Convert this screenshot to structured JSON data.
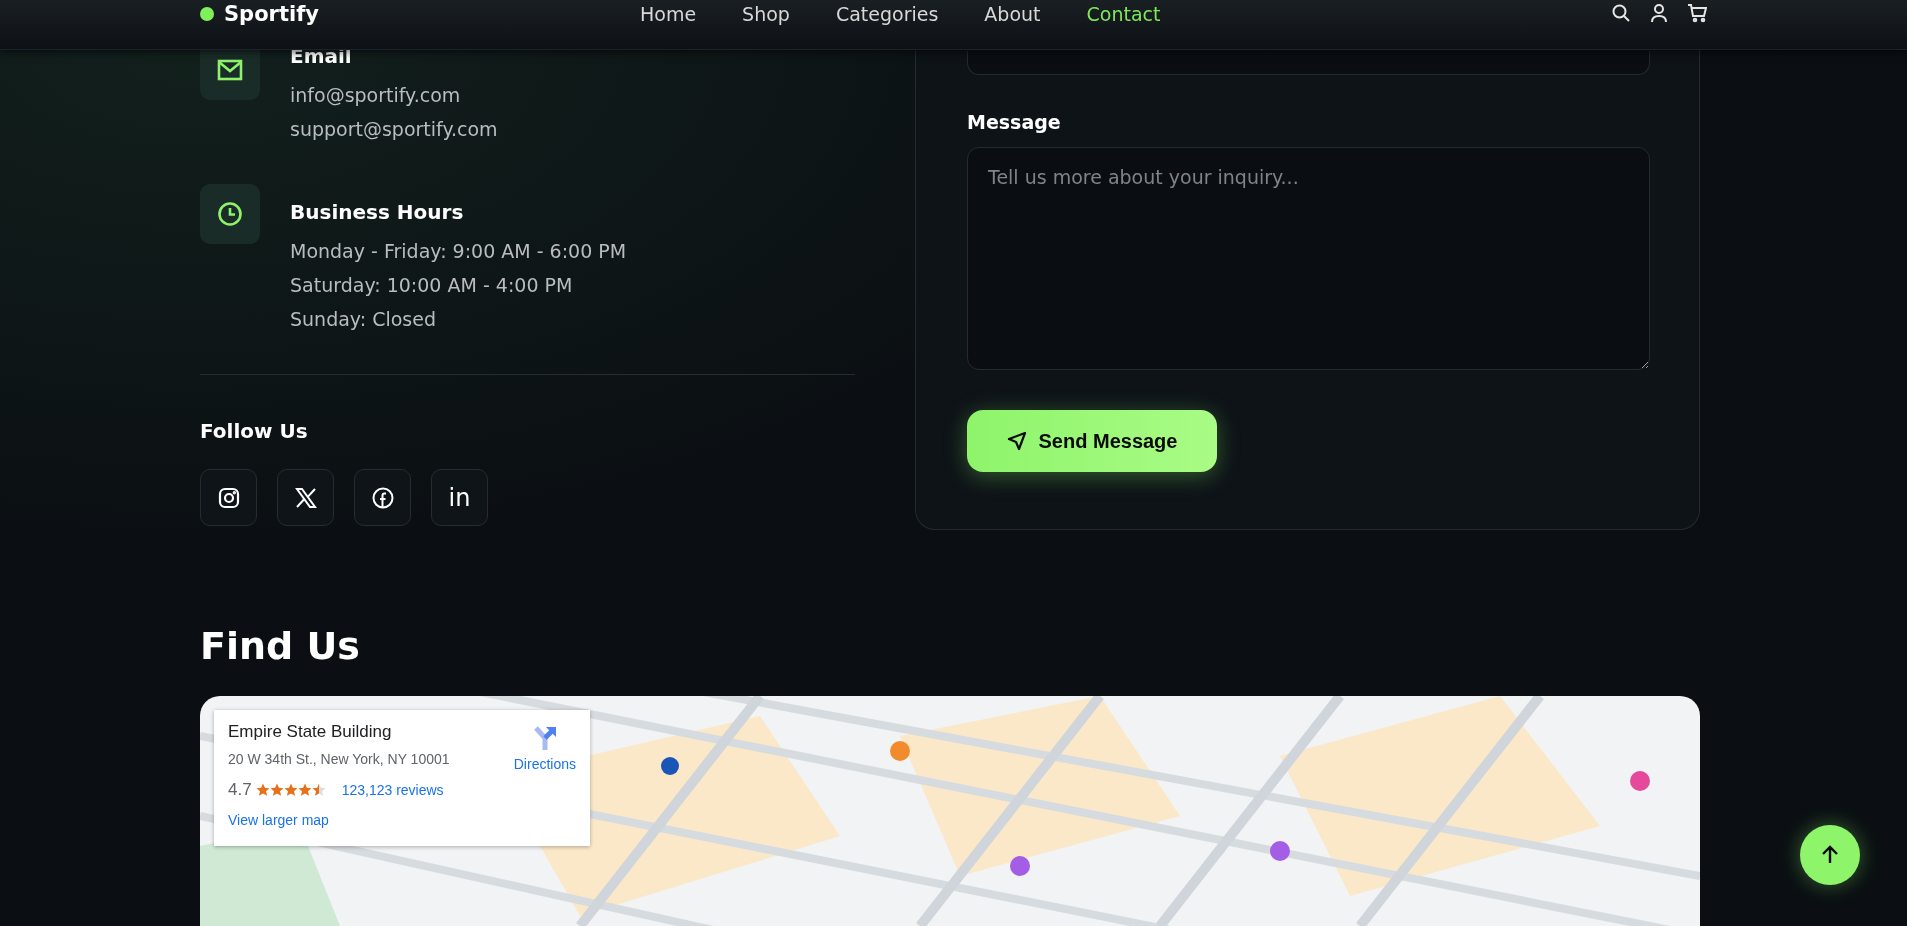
{
  "nav": {
    "logo": "Sportify",
    "links": [
      {
        "label": "Home",
        "selected": false
      },
      {
        "label": "Shop",
        "selected": false
      },
      {
        "label": "Categories",
        "selected": false
      },
      {
        "label": "About",
        "selected": false
      },
      {
        "label": "Contact",
        "selected": true
      }
    ]
  },
  "contact_items": [
    {
      "kind": "email",
      "title": "Email",
      "lines": [
        "info@sportify.com",
        "support@sportify.com"
      ]
    },
    {
      "kind": "hours",
      "title": "Business Hours",
      "lines": [
        "Monday - Friday: 9:00 AM - 6:00 PM",
        "Saturday: 10:00 AM - 4:00 PM",
        "Sunday: Closed"
      ]
    }
  ],
  "follow": {
    "title": "Follow Us",
    "networks": [
      {
        "kind": "instagram"
      },
      {
        "kind": "x"
      },
      {
        "kind": "facebook"
      },
      {
        "kind": "linkedin",
        "glyph": "in"
      }
    ]
  },
  "form": {
    "message_label": "Message",
    "message_placeholder": "Tell us more about your inquiry...",
    "send_button": "Send Message"
  },
  "find_us": {
    "title": "Find Us",
    "map": {
      "kind": "picture",
      "place_card": {
        "name": "Empire State Building",
        "address": "20 W 34th St., New York, NY 10001",
        "rating": "4.7",
        "stars": 4.5,
        "reviews": "123,123 reviews",
        "directions": "Directions",
        "larger_map": "View larger map"
      }
    }
  }
}
